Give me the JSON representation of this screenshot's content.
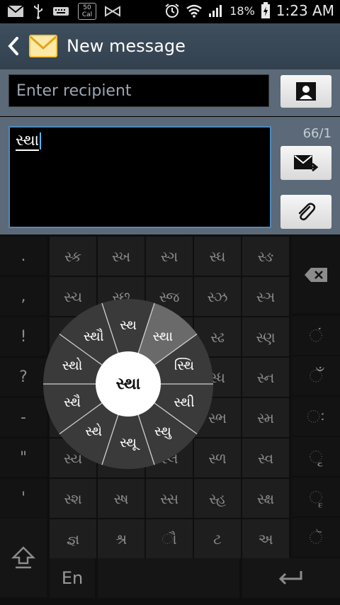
{
  "status_bar": {
    "notification_icons": [
      "mail-icon",
      "usb-icon",
      "keyboard-icon",
      "temperature-icon",
      "bowtie-icon"
    ],
    "temperature_top": "50",
    "temperature_bottom": "Cal",
    "battery": "18%",
    "time": "1:23 AM"
  },
  "action_bar": {
    "title": "New message"
  },
  "recipient": {
    "placeholder": "Enter recipient"
  },
  "compose": {
    "text": "સ્થા",
    "counter": "66/1"
  },
  "keyboard": {
    "left_column": [
      ".",
      ",",
      "!",
      "?",
      "-",
      "\"",
      "'"
    ],
    "grid": [
      [
        "સ્ક",
        "સ્ખ",
        "સ્ગ",
        "સ્ઘ",
        "સ્ઙ"
      ],
      [
        "સ્ચ",
        "સ્છ",
        "સ્જ",
        "સ્ઝ",
        "સ્ઞ"
      ],
      [
        "",
        "",
        "",
        "સ્ઢ",
        "સ્ણ"
      ],
      [
        "",
        "",
        "",
        "સ્ધ",
        "સ્ન"
      ],
      [
        "",
        "",
        "",
        "સ્ભ",
        "સ્મ"
      ],
      [
        "સ્ય",
        "",
        "સ્લ",
        "સ્ળ",
        "સ્વ"
      ],
      [
        "સ્શ",
        "સ્ષ",
        "સ્સ",
        "સ્હ",
        "સ્ક્ષ"
      ],
      [
        "જ્ઞ",
        "શ્ર",
        "ૌ",
        "ટ",
        "અ"
      ]
    ],
    "right_column": [
      "backspace",
      "ં",
      "ઁ",
      "ઃ",
      "ૃ",
      "ૄ",
      "ૅ"
    ],
    "language": "En",
    "radial": {
      "center": "સ્થા",
      "segments": [
        "સ્થ",
        "સ્થા",
        "સ્થિ",
        "સ્થી",
        "સ્થુ",
        "સ્થૂ",
        "સ્થે",
        "સ્થૈ",
        "સ્થો",
        "સ્થૌ"
      ]
    }
  },
  "colors": {
    "action_bar": "#3e4e5d",
    "panel": "#5b6978",
    "input_border": "#4f89bd",
    "radial_bg": "#3a3a3a",
    "radial_highlight": "#6a6a6a"
  }
}
